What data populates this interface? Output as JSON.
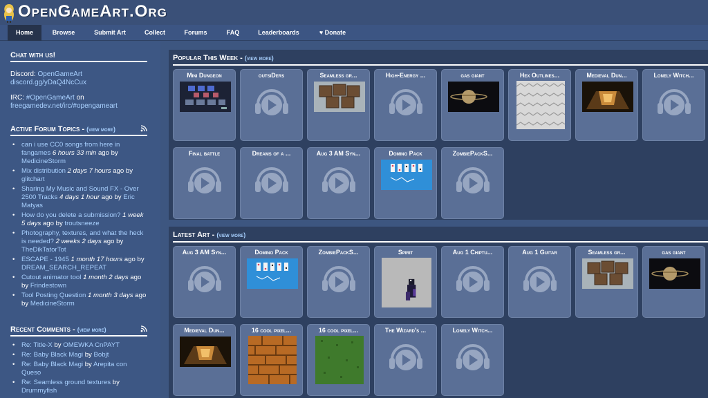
{
  "site": {
    "title": "OpenGameArt.Org"
  },
  "nav": [
    "Home",
    "Browse",
    "Submit Art",
    "Collect",
    "Forums",
    "FAQ",
    "Leaderboards",
    "Donate"
  ],
  "sidebar": {
    "chat": {
      "heading": "Chat with us!",
      "discord_label": "Discord: ",
      "discord_name": "OpenGameArt",
      "discord_link": "discord.gg/yDaQ4NcCux",
      "irc_label": "IRC: ",
      "irc_channel": "#OpenGameArt",
      "irc_on": " on",
      "irc_link": "freegamedev.net/irc/#opengameart"
    },
    "forum": {
      "heading": "Active Forum Topics - ",
      "more": "(view more)",
      "items": [
        {
          "title": "can i use CC0 songs from here in fangames",
          "time": "6 hours 33 min",
          "ago": " ago by ",
          "user": "MedicineStorm"
        },
        {
          "title": "Mix distribution",
          "time": "2 days 7 hours",
          "ago": " ago by ",
          "user": "glitchart"
        },
        {
          "title": "Sharing My Music and Sound FX - Over 2500 Tracks",
          "time": "4 days 1 hour",
          "ago": " ago by ",
          "user": "Eric Matyas"
        },
        {
          "title": "How do you delete a submission?",
          "time": "1 week 5 days",
          "ago": " ago by ",
          "user": "troutsneeze"
        },
        {
          "title": "Photography, textures, and what the heck is needed?",
          "time": "2 weeks 2 days",
          "ago": " ago by ",
          "user": "TheDikTatorTot"
        },
        {
          "title": "ESCAPE - 1945",
          "time": "1 month 17 hours",
          "ago": " ago by ",
          "user": "DREAM_SEARCH_REPEAT"
        },
        {
          "title": "Cutout animator tool",
          "time": "1 month 2 days",
          "ago": " ago by ",
          "user": "Frindestown"
        },
        {
          "title": "Tool Posting Question",
          "time": "1 month 3 days",
          "ago": " ago by ",
          "user": "MedicineStorm"
        }
      ]
    },
    "comments": {
      "heading": "Recent Comments - ",
      "more": "(view more)",
      "items": [
        {
          "title": "Re: Title-X",
          "by": " by ",
          "user": "OMEWKA CnPAYT"
        },
        {
          "title": "Re: Baby Black Magi",
          "by": " by ",
          "user": "Bobjt"
        },
        {
          "title": "Re: Baby Black Magi",
          "by": " by ",
          "user": "Arepita con Queso"
        },
        {
          "title": "Re: Seamless ground textures",
          "by": " by ",
          "user": "Drummyfish"
        }
      ]
    }
  },
  "popular": {
    "heading": "Popular This Week - ",
    "more": "(view more)",
    "tiles": [
      {
        "title": "Mini Dungeon",
        "thumb": "mini-dungeon"
      },
      {
        "title": "outsiDers",
        "thumb": "audio"
      },
      {
        "title": "Seamless gr...",
        "thumb": "crates"
      },
      {
        "title": "High-Energy ...",
        "thumb": "audio"
      },
      {
        "title": "gas giant",
        "thumb": "gas-giant"
      },
      {
        "title": "Hex Outlines...",
        "thumb": "hex"
      },
      {
        "title": "Medieval Dun...",
        "thumb": "medieval"
      },
      {
        "title": "Lonely Witch...",
        "thumb": "audio"
      },
      {
        "title": "Final battle",
        "thumb": "audio"
      },
      {
        "title": "Dreams of a ...",
        "thumb": "audio"
      },
      {
        "title": "Aug 3 AM Syn...",
        "thumb": "audio"
      },
      {
        "title": "Domino Pack",
        "thumb": "domino"
      },
      {
        "title": "ZombiePackS...",
        "thumb": "audio"
      }
    ]
  },
  "latest": {
    "heading": "Latest Art - ",
    "more": "(view more)",
    "tiles": [
      {
        "title": "Aug 3 AM Syn...",
        "thumb": "audio"
      },
      {
        "title": "Domino Pack",
        "thumb": "domino"
      },
      {
        "title": "ZombiePackS...",
        "thumb": "audio"
      },
      {
        "title": "Spirit",
        "thumb": "spirit"
      },
      {
        "title": "Aug 1 Chiptu...",
        "thumb": "audio"
      },
      {
        "title": "Aug 1 Guitar",
        "thumb": "audio"
      },
      {
        "title": "Seamless gr...",
        "thumb": "crates"
      },
      {
        "title": "gas giant",
        "thumb": "gas-giant"
      },
      {
        "title": "Medieval Dun...",
        "thumb": "medieval"
      },
      {
        "title": "16 cool pixel...",
        "thumb": "bricks"
      },
      {
        "title": "16 cool pixel...",
        "thumb": "grass"
      },
      {
        "title": "The Wizard's ...",
        "thumb": "audio"
      },
      {
        "title": "Lonely Witch...",
        "thumb": "audio"
      }
    ]
  }
}
